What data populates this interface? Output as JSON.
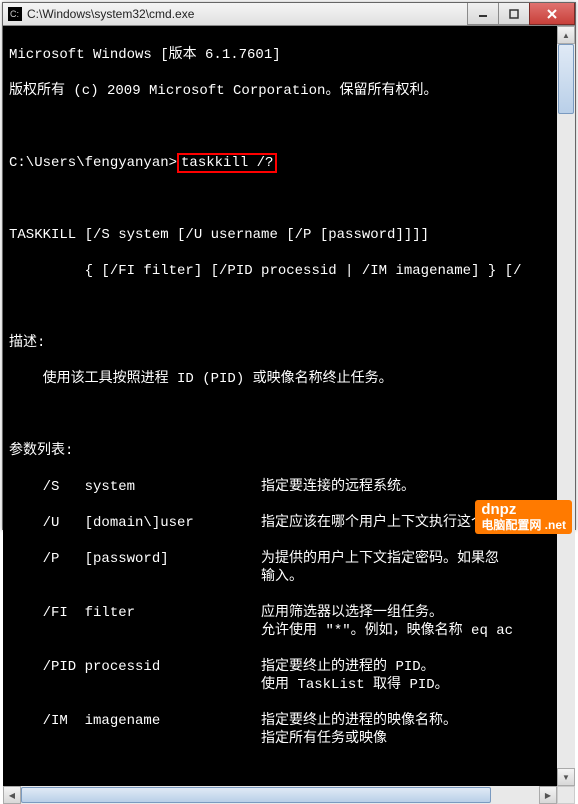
{
  "window": {
    "title": "C:\\Windows\\system32\\cmd.exe"
  },
  "header": {
    "line1": "Microsoft Windows [版本 6.1.7601]",
    "line2": "版权所有 (c) 2009 Microsoft Corporation。保留所有权利。"
  },
  "prompt": {
    "path": "C:\\Users\\fengyanyan>",
    "command": "taskkill /?"
  },
  "usage": {
    "line1": "TASKKILL [/S system [/U username [/P [password]]]]",
    "line2": "         { [/FI filter] [/PID processid | /IM imagename] } [/"
  },
  "desc": {
    "heading": "描述:",
    "text": "    使用该工具按照进程 ID (PID) 或映像名称终止任务。"
  },
  "params": {
    "heading": "参数列表:",
    "rows": [
      {
        "flag": "    /S   system",
        "desc1": "指定要连接的远程系统。",
        "desc2": ""
      },
      {
        "flag": "    /U   [domain\\]user",
        "desc1": "指定应该在哪个用户上下文执行这个命",
        "desc2": ""
      },
      {
        "flag": "    /P   [password]",
        "desc1": "为提供的用户上下文指定密码。如果忽",
        "desc2": "输入。"
      },
      {
        "flag": "    /FI  filter",
        "desc1": "应用筛选器以选择一组任务。",
        "desc2": "允许使用 \"*\"。例如，映像名称 eq ac"
      },
      {
        "flag": "    /PID processid",
        "desc1": "指定要终止的进程的 PID。",
        "desc2": "使用 TaskList 取得 PID。"
      },
      {
        "flag": "    /IM  imagename",
        "desc1": "指定要终止的进程的映像名称。",
        "desc2": "指定所有任务或映像"
      }
    ]
  },
  "watermark": {
    "main": "dnpz",
    "sub": "电脑配置网 .net"
  }
}
